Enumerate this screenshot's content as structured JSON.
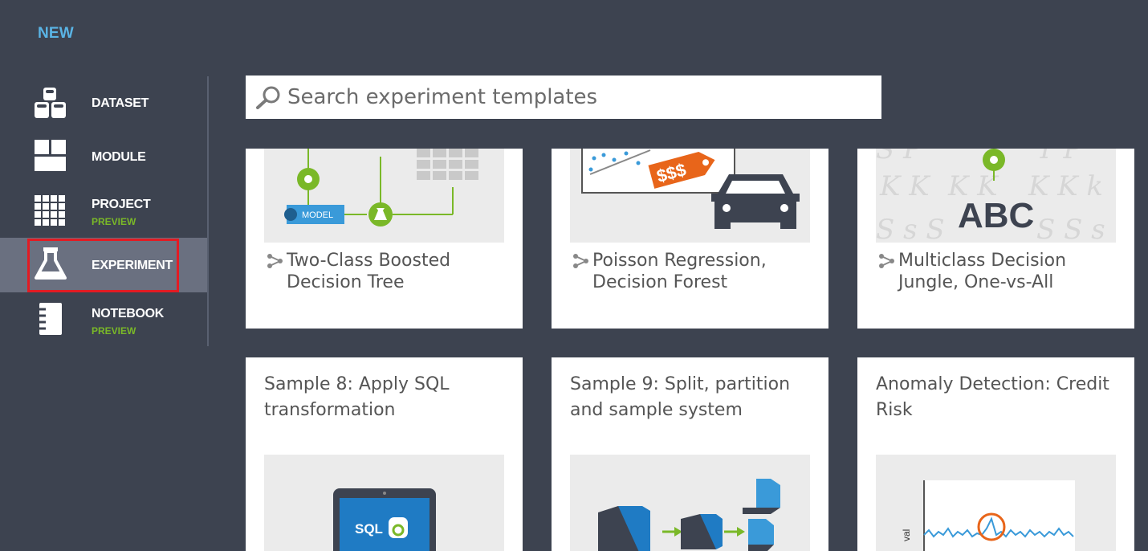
{
  "header": {
    "title": "NEW"
  },
  "sidebar": {
    "items": [
      {
        "label": "DATASET",
        "sub": ""
      },
      {
        "label": "MODULE",
        "sub": ""
      },
      {
        "label": "PROJECT",
        "sub": "PREVIEW"
      },
      {
        "label": "EXPERIMENT",
        "sub": ""
      },
      {
        "label": "NOTEBOOK",
        "sub": "PREVIEW"
      }
    ]
  },
  "search": {
    "placeholder": "Search experiment templates"
  },
  "cards": [
    {
      "title": "Two-Class Boosted Decision Tree",
      "thumb_label": "MODEL"
    },
    {
      "title": "Poisson Regression, Decision Forest",
      "thumb_label": "$$$"
    },
    {
      "title": "Multiclass Decision Jungle, One-vs-All",
      "thumb_label": "ABC"
    },
    {
      "title": "Sample 8: Apply SQL transformation",
      "thumb_label": "SQL"
    },
    {
      "title": "Sample 9: Split, partition and sample system"
    },
    {
      "title": "Anomaly Detection: Credit Risk",
      "thumb_label": "val"
    }
  ],
  "colors": {
    "background": "#3d4350",
    "accent_blue": "#5ab4e5",
    "preview_green": "#7ab828",
    "selected_bg": "#6a7080",
    "highlight": "#e31b23"
  }
}
